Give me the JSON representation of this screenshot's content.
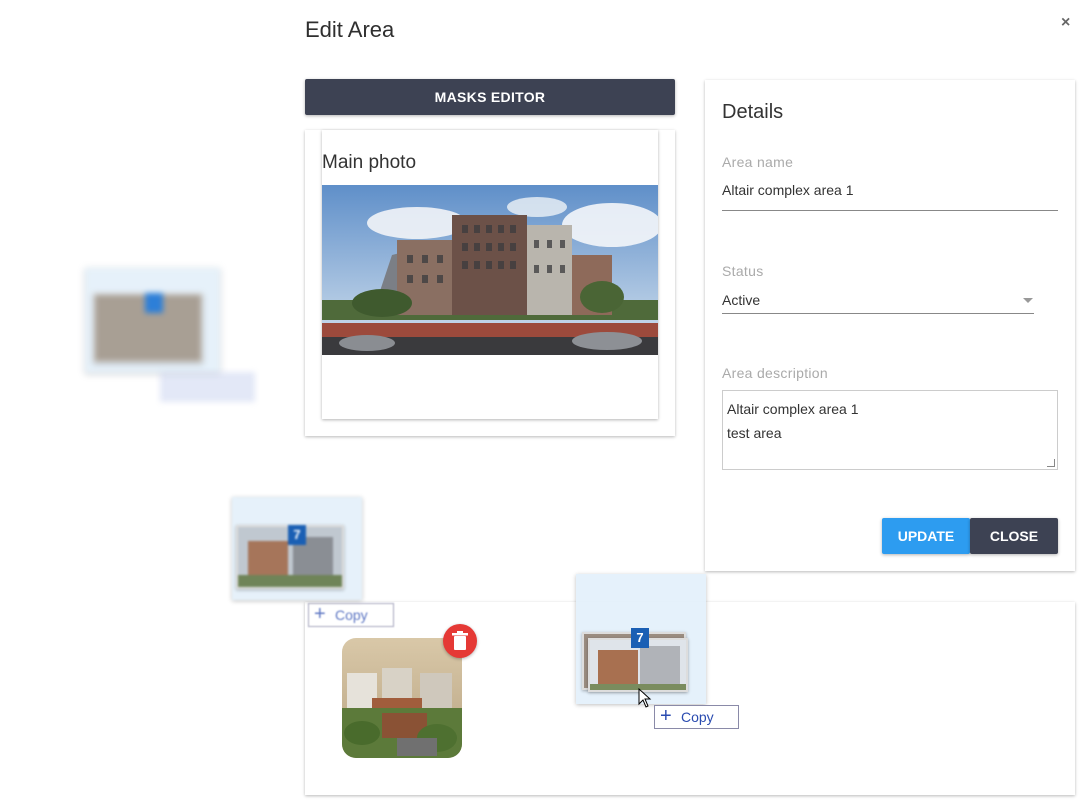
{
  "dialog": {
    "title": "Edit Area",
    "close_glyph": "×"
  },
  "toolbar": {
    "masks_editor_label": "MASKS EDITOR"
  },
  "main_photo": {
    "title": "Main photo"
  },
  "details": {
    "title": "Details",
    "area_name_label": "Area name",
    "area_name_value": "Altair complex area 1",
    "status_label": "Status",
    "status_value": "Active",
    "description_label": "Area description",
    "description_line1": "Altair complex area 1",
    "description_line2": "test area",
    "update_label": "UPDATE",
    "close_label": "CLOSE"
  },
  "drag": {
    "badge_count": "7",
    "copy_label": "Copy"
  },
  "colors": {
    "primary_dark": "#3d4253",
    "accent_blue": "#2d9cf0",
    "danger": "#e53935",
    "badge": "#1a5fb4"
  },
  "icons": [
    "close-icon",
    "chevron-down-icon",
    "trash-icon",
    "plus-icon",
    "cursor-icon"
  ]
}
